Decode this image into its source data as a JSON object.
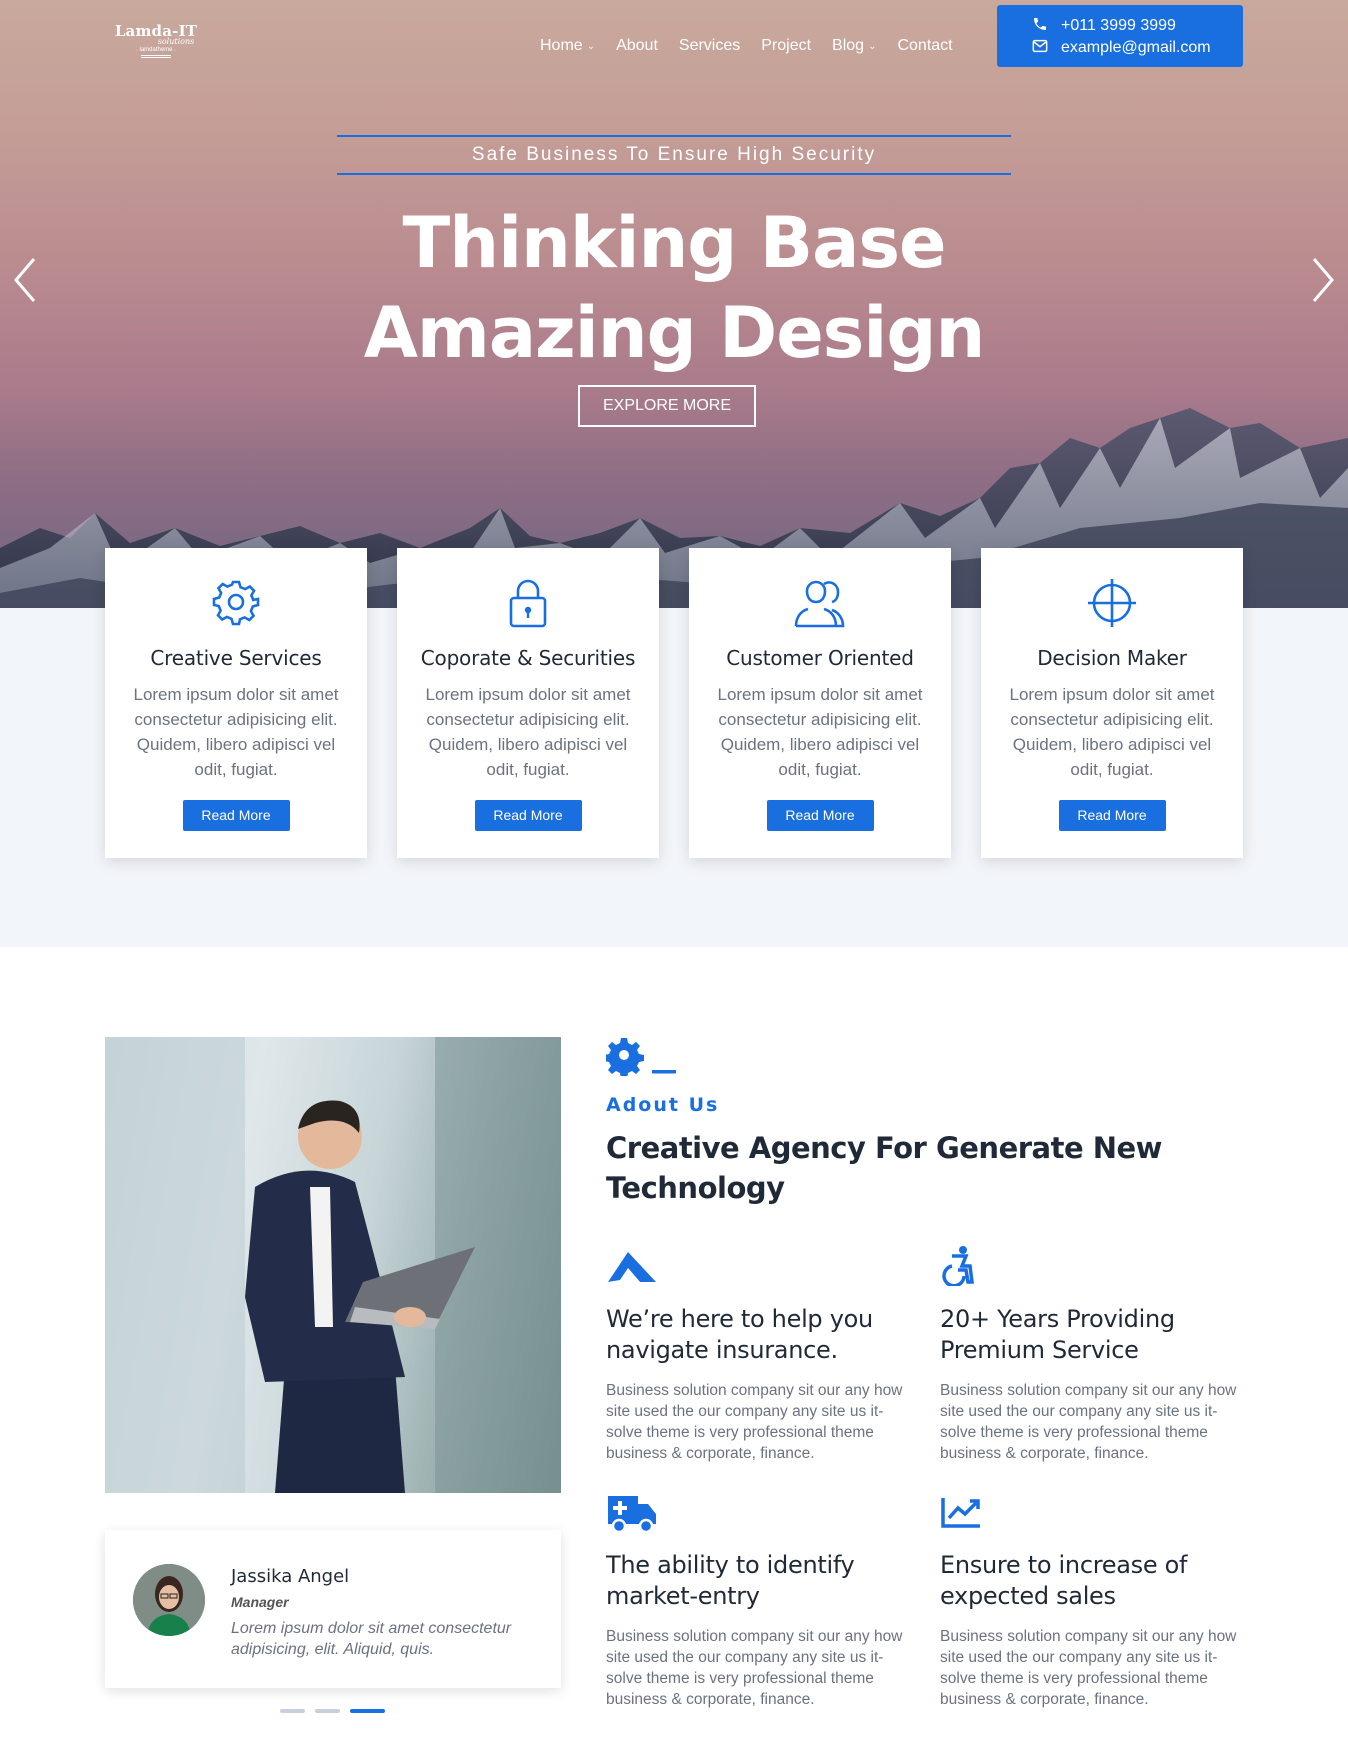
{
  "brand": {
    "line1": "Lamda-IT",
    "line2": "solutions",
    "line3": ". lamdatheme ."
  },
  "nav": {
    "items": [
      {
        "label": "Home",
        "dropdown": true
      },
      {
        "label": "About",
        "dropdown": false
      },
      {
        "label": "Services",
        "dropdown": false
      },
      {
        "label": "Project",
        "dropdown": false
      },
      {
        "label": "Blog",
        "dropdown": true
      },
      {
        "label": "Contact",
        "dropdown": false
      }
    ]
  },
  "contact": {
    "phone": "+011 3999 3999",
    "email": "example@gmail.com",
    "phone_icon": "phone-icon",
    "email_icon": "envelope-icon"
  },
  "hero": {
    "tagline": "Safe Business To Ensure High Security",
    "title_line1": "Thinking Base",
    "title_line2": "Amazing Design",
    "cta": "EXPLORE MORE",
    "prev_icon": "chevron-left-icon",
    "next_icon": "chevron-right-icon"
  },
  "services": [
    {
      "icon": "gear-icon",
      "title": "Creative Services",
      "text": "Lorem ipsum dolor sit amet consectetur adipisicing elit. Quidem, libero adipisci vel odit, fugiat.",
      "button": "Read More"
    },
    {
      "icon": "lock-icon",
      "title": "Coporate & Securities",
      "text": "Lorem ipsum dolor sit amet consectetur adipisicing elit. Quidem, libero adipisci vel odit, fugiat.",
      "button": "Read More"
    },
    {
      "icon": "users-icon",
      "title": "Customer Oriented",
      "text": "Lorem ipsum dolor sit amet consectetur adipisicing elit. Quidem, libero adipisci vel odit, fugiat.",
      "button": "Read More"
    },
    {
      "icon": "crosshair-icon",
      "title": "Decision Maker",
      "text": "Lorem ipsum dolor sit amet consectetur adipisicing elit. Quidem, libero adipisci vel odit, fugiat.",
      "button": "Read More"
    }
  ],
  "about": {
    "kicker": "Adout Us",
    "title": "Creative Agency For Generate New Technology",
    "features": [
      {
        "icon": "paper-plane-icon",
        "title": "We’re here to help you navigate insurance.",
        "text": "Business solution company sit our any how site used the our company any site us it-solve theme is very professional theme business & corporate, finance."
      },
      {
        "icon": "accessibility-icon",
        "title": "20+ Years Providing Premium Service",
        "text": "Business solution company sit our any how site used the our company any site us it-solve theme is very professional theme business & corporate, finance."
      },
      {
        "icon": "ambulance-icon",
        "title": "The ability to identify market-entry",
        "text": "Business solution company sit our any how site used the our company any site us it-solve theme is very professional theme business & corporate, finance."
      },
      {
        "icon": "chart-line-icon",
        "title": "Ensure to increase of expected sales",
        "text": "Business solution company sit our any how site used the our company any site us it-solve theme is very professional theme business & corporate, finance."
      }
    ]
  },
  "testimonial": {
    "name": "Jassika Angel",
    "role": "Manager",
    "quote": "Lorem ipsum dolor sit amet consectetur adipisicing, elit. Aliquid, quis.",
    "slides": 3,
    "active_slide": 3
  },
  "colors": {
    "accent": "#1a6fe0",
    "band_bg": "#f2f5f9",
    "heading": "#1f2937",
    "body_text": "#6b7280"
  }
}
